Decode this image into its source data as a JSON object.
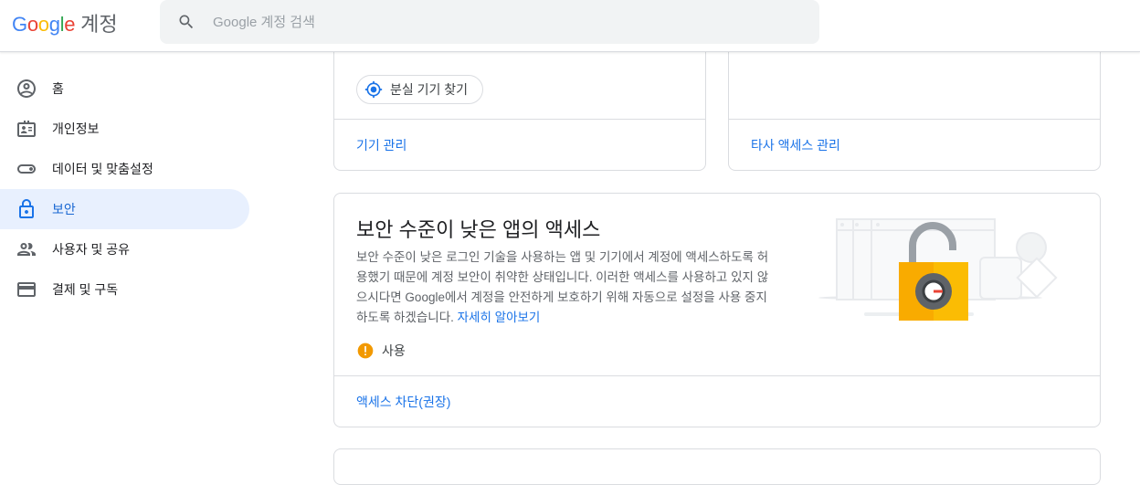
{
  "header": {
    "logo_text": "Google",
    "product_name": "계정",
    "search_placeholder": "Google 계정 검색",
    "brand_colors": [
      "#4285f4",
      "#ea4335",
      "#fbbc05",
      "#4285f4",
      "#34a853",
      "#ea4335"
    ]
  },
  "sidebar": {
    "items": [
      {
        "label": "홈",
        "icon": "account-circle-icon"
      },
      {
        "label": "개인정보",
        "icon": "id-card-icon"
      },
      {
        "label": "데이터 및 맞춤설정",
        "icon": "toggle-icon"
      },
      {
        "label": "보안",
        "icon": "lock-icon",
        "active": true
      },
      {
        "label": "사용자 및 공유",
        "icon": "people-icon"
      },
      {
        "label": "결제 및 구독",
        "icon": "credit-card-icon"
      }
    ]
  },
  "devices_card": {
    "find_device_label": "분실 기기 찾기",
    "footer_link": "기기 관리"
  },
  "third_party_card": {
    "footer_link": "타사 액세스 관리"
  },
  "less_secure_card": {
    "title": "보안 수준이 낮은 앱의 액세스",
    "description": "보안 수준이 낮은 로그인 기술을 사용하는 앱 및 기기에서 계정에 액세스하도록 허용했기 때문에 계정 보안이 취약한 상태입니다. 이러한 액세스를 사용하고 있지 않으시다면 Google에서 계정을 안전하게 보호하기 위해 자동으로 설정을 사용 중지하도록 하겠습니다.",
    "learn_more": "자세히 알아보기",
    "status_label": "사용",
    "footer_link": "액세스 차단(권장)"
  },
  "colors": {
    "accent": "#1a73e8",
    "active_bg": "#e8f0fe",
    "warning": "#f29900"
  }
}
